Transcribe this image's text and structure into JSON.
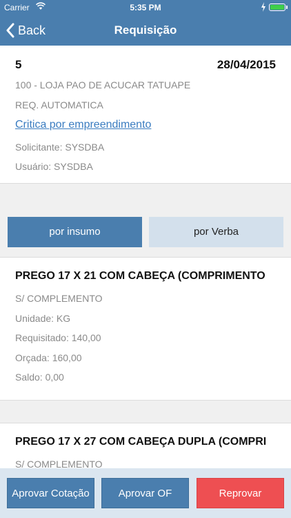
{
  "status_bar": {
    "carrier": "Carrier",
    "time": "5:35 PM",
    "battery_color": "#3fce4a"
  },
  "nav": {
    "back_label": "Back",
    "title": "Requisição",
    "color": "#4a7eae"
  },
  "requisition": {
    "number": "5",
    "date": "28/04/2015",
    "store": "100 - LOJA PAO DE ACUCAR TATUAPE",
    "type": "REQ. AUTOMATICA",
    "link": "Critica por empreendimento",
    "requester": "Solicitante: SYSDBA",
    "user": "Usuário: SYSDBA"
  },
  "tabs": [
    {
      "label": "por insumo",
      "active": true
    },
    {
      "label": "por Verba",
      "active": false
    }
  ],
  "items": [
    {
      "name": "PREGO 17 X 21 COM CABEÇA (COMPRIMENTO",
      "complement": "S/ COMPLEMENTO",
      "unit": "Unidade: KG",
      "requested": "Requisitado: 140,00",
      "budgeted": "Orçada: 160,00",
      "balance": "Saldo: 0,00"
    },
    {
      "name": "PREGO 17 X 27 COM CABEÇA DUPLA (COMPRI",
      "complement": "S/ COMPLEMENTO"
    }
  ],
  "actions": {
    "approve_quote": "Aprovar Cotação",
    "approve_of": "Aprovar OF",
    "reject": "Reprovar",
    "reject_color": "#ee4f52"
  }
}
